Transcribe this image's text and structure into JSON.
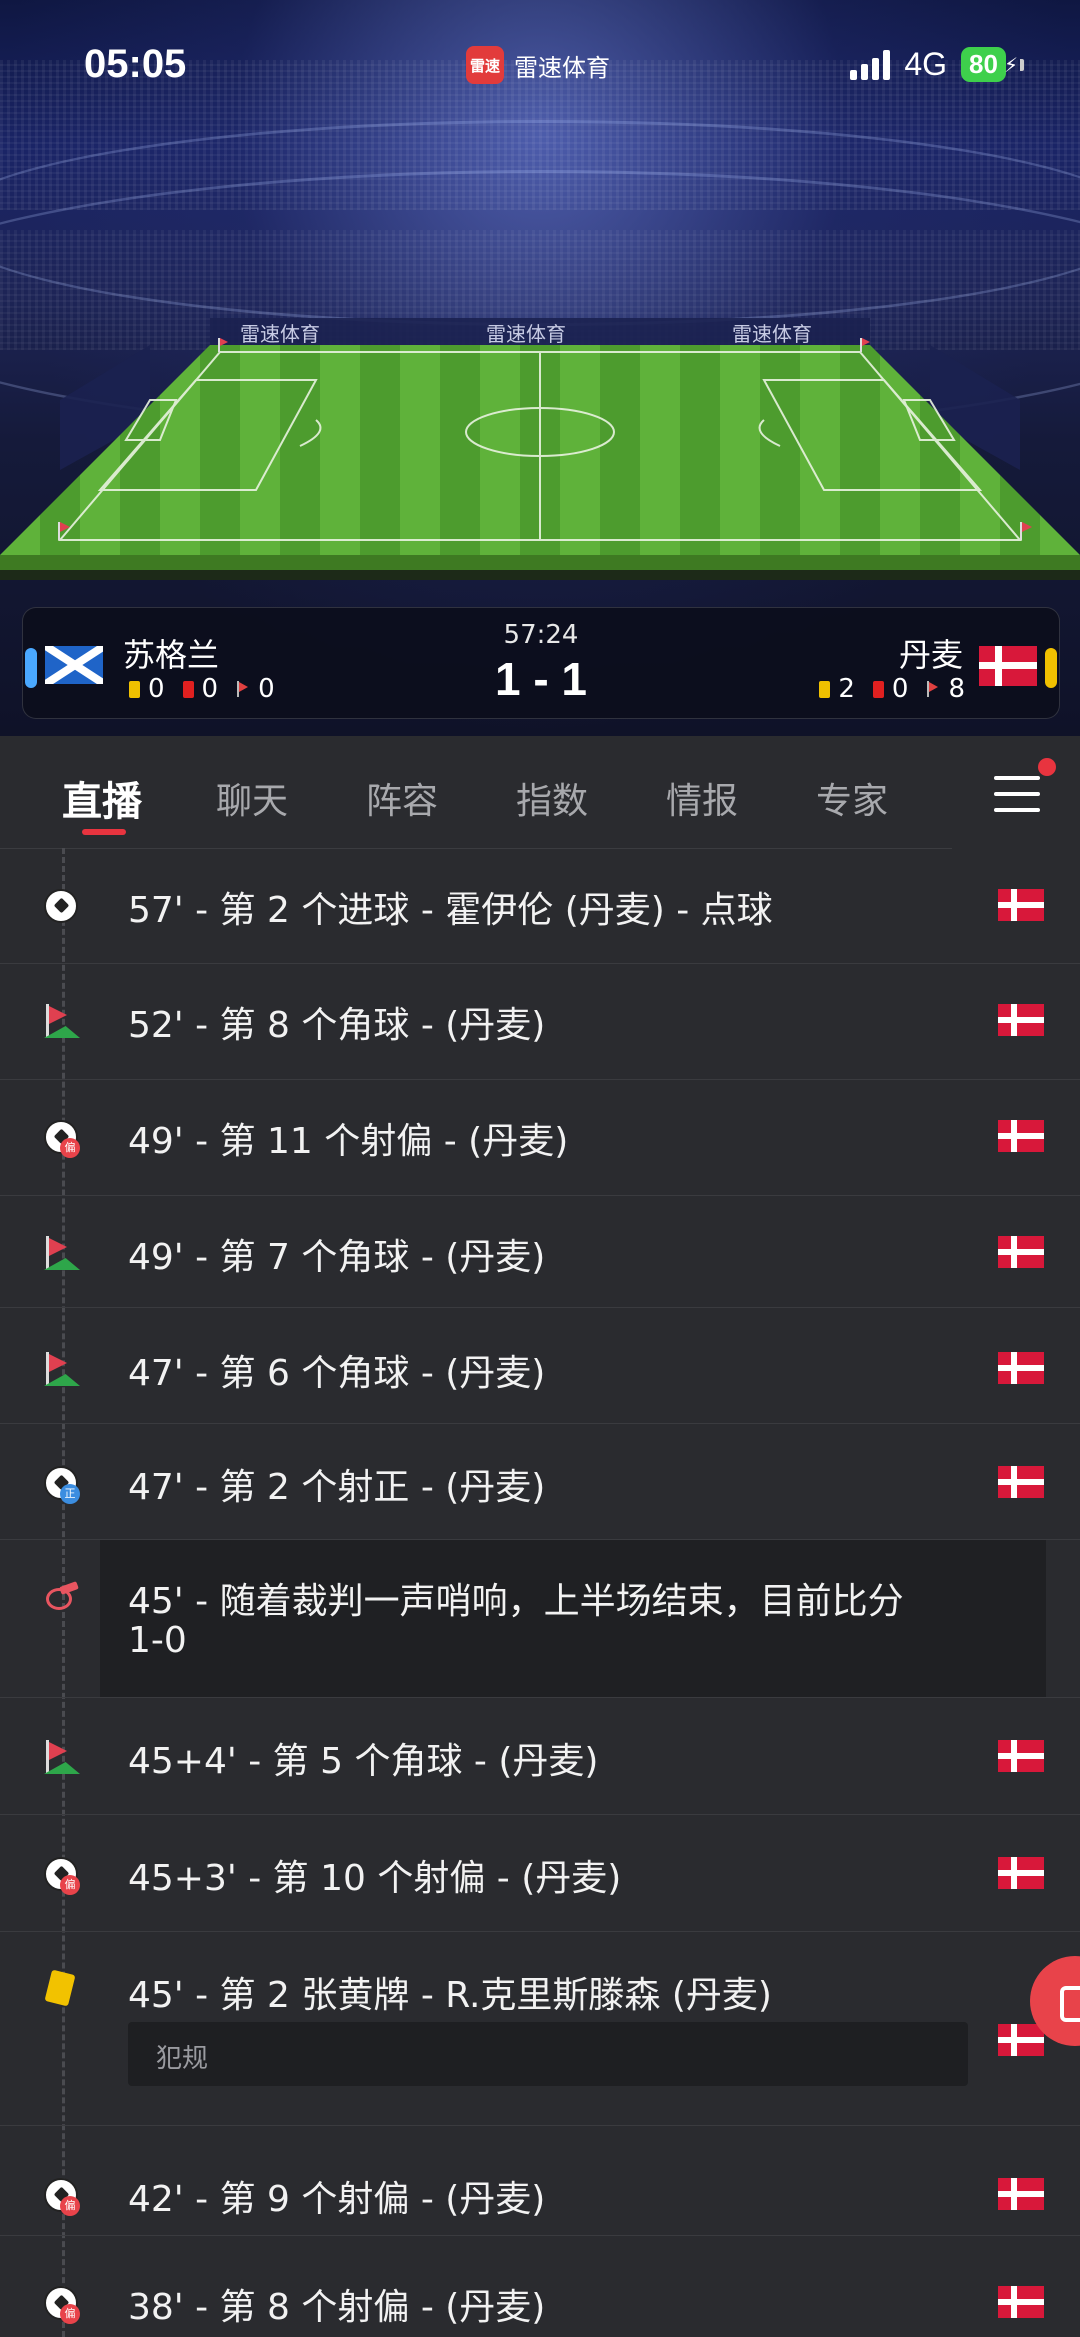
{
  "status_bar": {
    "time": "05:05",
    "app_logo_text": "雷速",
    "app_name": "雷速体育",
    "network": "4G",
    "battery": "80"
  },
  "pitch_ads": [
    "雷速体育",
    "雷速体育",
    "雷速体育"
  ],
  "scoreboard": {
    "match_time": "57:24",
    "score": "1 - 1",
    "home": {
      "name": "苏格兰",
      "yellow": "0",
      "red": "0",
      "corners": "0",
      "side_color": "#4aa8ff"
    },
    "away": {
      "name": "丹麦",
      "yellow": "2",
      "red": "0",
      "corners": "8",
      "side_color": "#f0c000"
    }
  },
  "tabs": [
    "直播",
    "聊天",
    "阵容",
    "指数",
    "情报",
    "专家"
  ],
  "events": [
    {
      "icon": "ball-icon",
      "text": "57' - 第 2 个进球 - 霍伊伦 (丹麦) - 点球",
      "flag": "denmark"
    },
    {
      "icon": "corner-flag-icon",
      "text": "52' - 第 8 个角球 - (丹麦)",
      "flag": "denmark"
    },
    {
      "icon": "shot-off-target-icon",
      "badge": "偏",
      "text": "49' - 第 11 个射偏 - (丹麦)",
      "flag": "denmark"
    },
    {
      "icon": "corner-flag-icon",
      "text": "49' - 第 7 个角球 - (丹麦)",
      "flag": "denmark"
    },
    {
      "icon": "corner-flag-icon",
      "text": "47' - 第 6 个角球 - (丹麦)",
      "flag": "denmark"
    },
    {
      "icon": "shot-on-target-icon",
      "badge": "正",
      "text": "47' - 第 2 个射正 - (丹麦)",
      "flag": "denmark"
    },
    {
      "icon": "whistle-icon",
      "text_line1": "45' - 随着裁判一声哨响，上半场结束，目前比分",
      "text_line2": "1-0"
    },
    {
      "icon": "corner-flag-icon",
      "text": "45+4' - 第 5 个角球 - (丹麦)",
      "flag": "denmark"
    },
    {
      "icon": "shot-off-target-icon",
      "badge": "偏",
      "text": "45+3' - 第 10 个射偏 - (丹麦)",
      "flag": "denmark"
    },
    {
      "icon": "yellow-card-icon",
      "text": "45' - 第 2 张黄牌 - R.克里斯滕森 (丹麦)",
      "detail": "犯规",
      "flag": "denmark"
    },
    {
      "icon": "shot-off-target-icon",
      "badge": "偏",
      "text": "42' - 第 9 个射偏 - (丹麦)",
      "flag": "denmark"
    },
    {
      "icon": "shot-off-target-icon",
      "badge": "偏",
      "text": "38' - 第 8 个射偏 - (丹麦)",
      "flag": "denmark"
    }
  ],
  "colors": {
    "accent": "#e8343f",
    "background": "#2a2b2f",
    "pitch": "#5aa832"
  }
}
